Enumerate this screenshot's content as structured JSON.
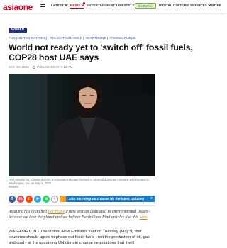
{
  "header": {
    "logo_asia": "asia",
    "logo_one": "one",
    "nav": [
      {
        "label": "LATEST"
      },
      {
        "label": "NEWS"
      },
      {
        "label": "ENTERTAINMENT"
      },
      {
        "label": "LIFESTYLE"
      },
      {
        "label": "EarthOne"
      },
      {
        "label": "DIGITAL CULTURE"
      },
      {
        "label": "SERVICES"
      },
      {
        "label": "MORE"
      }
    ],
    "accent_color": "#d0021b"
  },
  "article": {
    "section_badge": "WORLD",
    "tags": [
      "#UN (UNITED NATIONS)",
      "#CLIMATE CHANGE",
      "#EARTHONE",
      "#FOSSIL FUELS"
    ],
    "headline": "World not ready yet to 'switch off' fossil fuels, COP28 host UAE says",
    "date": "MAY 10, 2023",
    "published": "PUBLISHED AT 9:18 AM",
    "caption": "UAE Minister for Climate and the Environment Mariam Almheiri is pictured during an interview with Reuters in Washington, US, on May 9, 2023.",
    "caption_credit": "Reuters",
    "share_icons": [
      "facebook-icon",
      "messenger-icon",
      "reddit-icon",
      "telegram-icon",
      "whatsapp-icon",
      "more-share-icon"
    ],
    "telegram_banner": "Join our telegram channel for the latest updates!",
    "intro_1": "AsiaOne has launched ",
    "intro_link": "EarthOne",
    "intro_2": " a new section dedicated to environmental issues - because we love the planet and we believe Earth Ones Find articles like this ",
    "intro_link_2": "here",
    "intro_end": ".",
    "body": "WASHINGTON - The United Arab Emirates said on Tuesday (May 9) that countries should agree to phase out fossil fuels - not the production of oil, gas and coal - at the upcoming UN climate change negotiations that it will"
  }
}
